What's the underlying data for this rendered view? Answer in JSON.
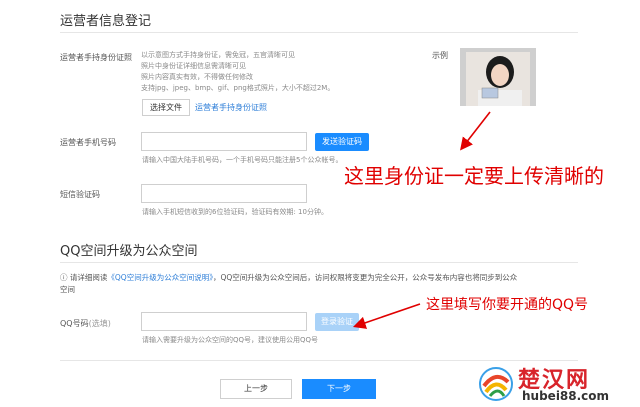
{
  "operator_section": {
    "title": "运营者信息登记",
    "id_photo": {
      "label": "运营者手持身份证照",
      "hints": [
        "以示意图方式手持身份证，需免冠，五官清晰可见",
        "照片中身份证详细信息需清晰可见",
        "照片内容真实有效，不得做任何修改",
        "支持jpg、jpeg、bmp、gif、png格式照片，大小不超过2M。"
      ],
      "choose_file_label": "选择文件",
      "file_link": "运营者手持身份证照",
      "example_label": "示例"
    },
    "phone": {
      "label": "运营者手机号码",
      "value": "",
      "send_code_label": "发送验证码",
      "hint": "请输入中国大陆手机号码，一个手机号码只能注册5个公众帐号。"
    },
    "sms": {
      "label": "短信验证码",
      "value": "",
      "hint": "请输入手机短信收到的6位验证码，验证码有效期: 10分钟。"
    }
  },
  "qq_section": {
    "title": "QQ空间升级为公众空间",
    "note_prefix": "请详细阅读",
    "note_link": "《QQ空间升级为公众空间说明》",
    "note_line1_suffix": "，QQ空间升级为公众空间后，访问权限将变更为完全公开，公众号发布内容也将同步到公众",
    "note_line2": "空间",
    "qq": {
      "label": "QQ号码",
      "optional": "(选填)",
      "value": "",
      "verify_label": "登录验证",
      "hint": "请输入需要升级为公众空间的QQ号，建议使用公用QQ号"
    }
  },
  "footer": {
    "prev_label": "上一步",
    "next_label": "下一步"
  },
  "annotations": {
    "id_note": "这里身份证一定要上传清晰的",
    "qq_note": "这里填写你要开通的QQ号"
  },
  "watermark": {
    "name": "楚汉网",
    "url": "hubei88.com"
  },
  "colors": {
    "primary": "#1a8cff",
    "disabled": "#a9d2f8",
    "annotation": "#e00000",
    "link": "#2f7fd8"
  }
}
